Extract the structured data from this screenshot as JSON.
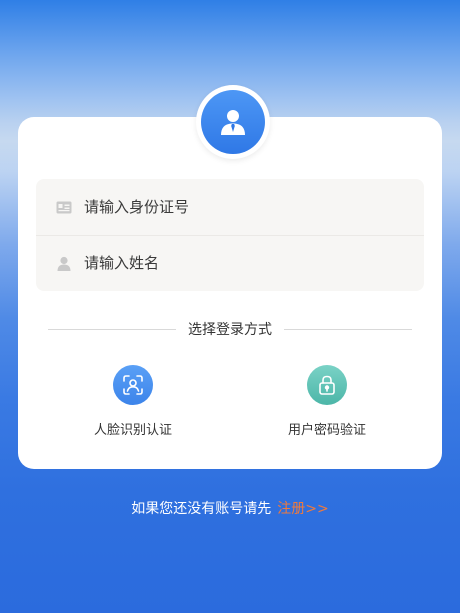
{
  "login_form": {
    "id_input": {
      "placeholder": "请输入身份证号",
      "value": "",
      "icon": "id-card-icon"
    },
    "name_input": {
      "placeholder": "请输入姓名",
      "value": "",
      "icon": "person-icon"
    }
  },
  "avatar": {
    "icon": "user-avatar-icon"
  },
  "login_methods": {
    "divider_text": "选择登录方式",
    "items": [
      {
        "label": "人脸识别认证",
        "icon": "face-scan-icon",
        "color": "#3c84ea"
      },
      {
        "label": "用户密码验证",
        "icon": "lock-icon",
        "color": "#4cb6a8"
      }
    ]
  },
  "footer": {
    "prompt": "如果您还没有账号请先",
    "register_link": "注册>>",
    "link_color": "#f07a3c"
  }
}
